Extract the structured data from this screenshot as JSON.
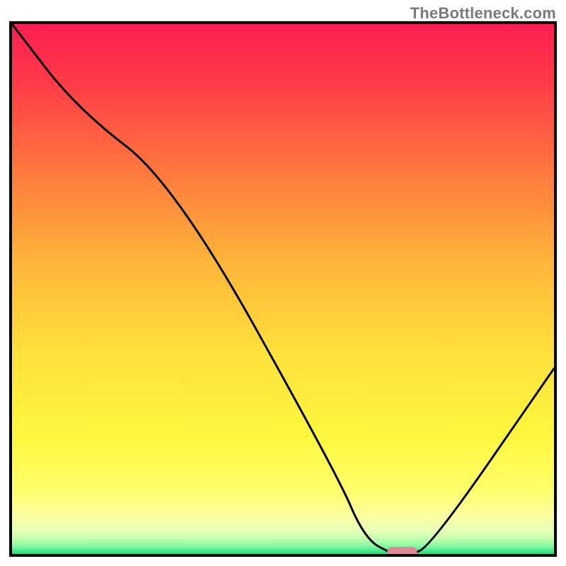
{
  "watermark": "TheBottleneck.com",
  "chart_data": {
    "type": "line",
    "title": "",
    "xlabel": "",
    "ylabel": "",
    "xlim": [
      0,
      100
    ],
    "ylim": [
      0,
      100
    ],
    "grid": false,
    "legend": false,
    "series": [
      {
        "name": "bottleneck-curve",
        "x": [
          0,
          12,
          30,
          60,
          65,
          70,
          73,
          77,
          100
        ],
        "y": [
          100,
          84,
          70,
          15,
          3,
          0,
          0,
          1,
          35
        ]
      }
    ],
    "marker": {
      "name": "optimal-point",
      "x": 72,
      "y": 0,
      "color": "#e18693",
      "shape": "rounded-bar"
    },
    "background_gradient": {
      "stops": [
        {
          "pos": 0.0,
          "color": "#ff1f52"
        },
        {
          "pos": 0.1,
          "color": "#ff3748"
        },
        {
          "pos": 0.25,
          "color": "#ff6e3e"
        },
        {
          "pos": 0.45,
          "color": "#ffb53a"
        },
        {
          "pos": 0.62,
          "color": "#ffe13c"
        },
        {
          "pos": 0.78,
          "color": "#fff73e"
        },
        {
          "pos": 0.88,
          "color": "#ffff6b"
        },
        {
          "pos": 0.93,
          "color": "#fbffa2"
        },
        {
          "pos": 0.955,
          "color": "#e9ffb8"
        },
        {
          "pos": 0.97,
          "color": "#c7ffaf"
        },
        {
          "pos": 0.985,
          "color": "#88f9a3"
        },
        {
          "pos": 0.995,
          "color": "#3fe889"
        },
        {
          "pos": 1.0,
          "color": "#19db77"
        }
      ]
    }
  }
}
